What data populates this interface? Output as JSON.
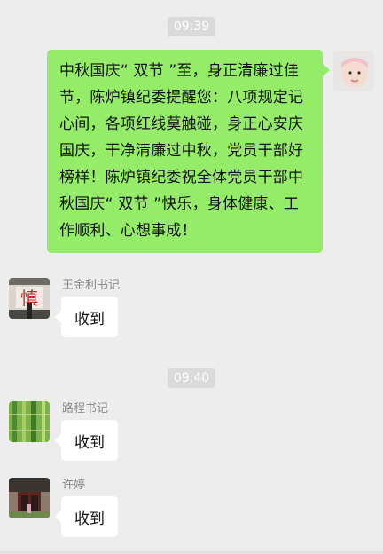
{
  "messages": [
    {
      "time": "09:39"
    },
    {
      "sender": "self",
      "text": "中秋国庆“ 双节 ”至，身正清廉过佳节，陈炉镇纪委提醒您：八项规定记心间，各项红线莫触碰，身正心安庆国庆，干净清廉过中秋，党员干部好榜样！陈炉镇纪委祝全体党员干部中秋国庆“ 双节 ”快乐，身体健康、工作顺利、心想事成！"
    },
    {
      "sender": "王金利书记",
      "text": "收到"
    },
    {
      "time": "09:40"
    },
    {
      "sender": "路程书记",
      "text": "收到"
    },
    {
      "sender": "许婷",
      "text": "收到"
    }
  ],
  "colors": {
    "background": "#ededed",
    "sent_bubble": "#95ec69",
    "received_bubble": "#ffffff",
    "timestamp_bg": "#dadada"
  }
}
